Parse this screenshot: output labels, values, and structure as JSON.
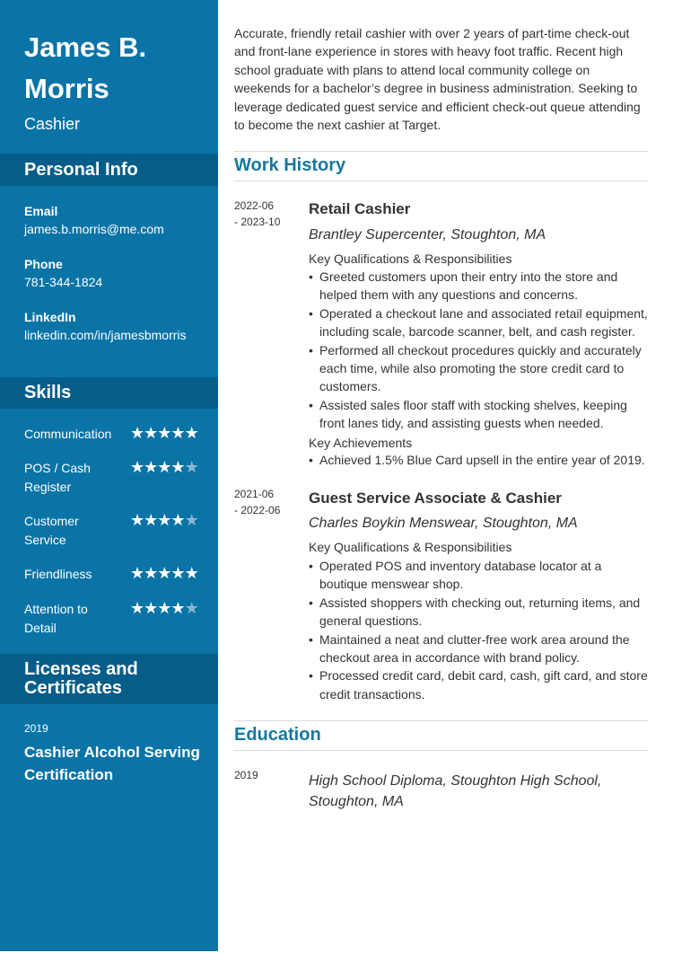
{
  "sidebar": {
    "name": "James B. Morris",
    "title": "Cashier",
    "personal_info": {
      "heading": "Personal Info",
      "email_label": "Email",
      "email": "james.b.morris@me.com",
      "phone_label": "Phone",
      "phone": "781-344-1824",
      "linkedin_label": "LinkedIn",
      "linkedin": "linkedin.com/in/jamesbmorris"
    },
    "skills": {
      "heading": "Skills",
      "max_rating": 5,
      "items": [
        {
          "name": "Communication",
          "rating": 5
        },
        {
          "name": "POS / Cash Register",
          "rating": 4
        },
        {
          "name": "Customer Service",
          "rating": 4
        },
        {
          "name": "Friendliness",
          "rating": 5
        },
        {
          "name": "Attention to Detail",
          "rating": 4
        }
      ]
    },
    "licenses": {
      "heading": "Licenses and Certificates",
      "items": [
        {
          "year": "2019",
          "name": "Cashier Alcohol Serving Certification"
        }
      ]
    }
  },
  "main": {
    "summary": "Accurate, friendly retail cashier with over 2 years of part-time check-out and front-lane experience in stores with heavy foot traffic. Recent high school graduate with plans to attend local community college on weekends for a bachelor’s degree in business administration. Seeking to leverage dedicated guest service and efficient check-out queue attending to become the next cashier at Target.",
    "work_history": {
      "heading": "Work History",
      "jobs": [
        {
          "date_start": "2022-06",
          "date_end": "- 2023-10",
          "title": "Retail Cashier",
          "company": "Brantley Supercenter, Stoughton, MA",
          "responsibilities_label": "Key Qualifications & Responsibilities",
          "responsibilities": [
            "Greeted customers upon their entry into the store and helped them with any questions and concerns.",
            "Operated a checkout lane and associated retail equipment, including scale, barcode scanner, belt, and cash register.",
            "Performed all checkout procedures quickly and accurately each time, while also promoting the store credit card to customers.",
            "Assisted sales floor staff with stocking shelves, keeping front lanes tidy, and assisting guests when needed."
          ],
          "achievements_label": "Key Achievements",
          "achievements": [
            "Achieved 1.5% Blue Card upsell in the entire year of 2019."
          ]
        },
        {
          "date_start": "2021-06",
          "date_end": "- 2022-06",
          "title": "Guest Service Associate & Cashier",
          "company": "Charles Boykin Menswear, Stoughton, MA",
          "responsibilities_label": "Key Qualifications & Responsibilities",
          "responsibilities": [
            "Operated POS and inventory database locator at a boutique menswear shop.",
            "Assisted shoppers with checking out, returning items, and general questions.",
            "Maintained a neat and clutter-free work area around the checkout area in accordance with brand policy.",
            "Processed credit card, debit card, cash, gift card, and store credit transactions."
          ]
        }
      ]
    },
    "education": {
      "heading": "Education",
      "items": [
        {
          "year": "2019",
          "degree": "High School Diploma, Stoughton High School, Stoughton, MA"
        }
      ]
    }
  },
  "colors": {
    "sidebar": "#0b74a7",
    "sidebar_header": "#075d89",
    "accent": "#16789f",
    "star_filled": "#ffffff",
    "star_empty": "#8ab8d3"
  }
}
